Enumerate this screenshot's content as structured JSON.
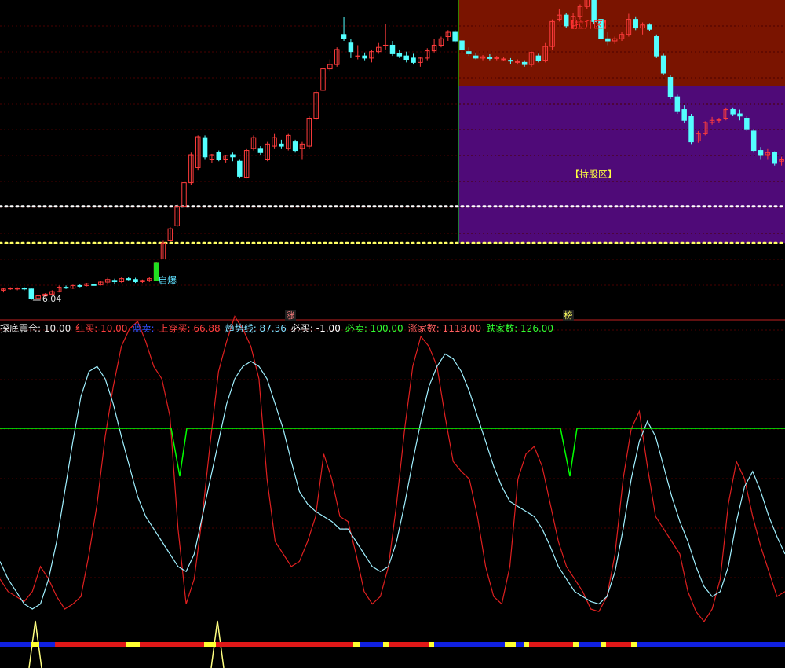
{
  "colors": {
    "background": "#000000",
    "candle_up": "#ff3c3c",
    "candle_down": "#54ffff",
    "zone_pull": "#7a1400",
    "zone_hold": "#4f0a78",
    "zone_divider": "#00d000",
    "dotted_line": "#ffffff",
    "dotted_line_low": "#ffff64",
    "grid": "#4a0000",
    "red_line": "#e02020",
    "cyan_line": "#a0f0ff",
    "green_line": "#00ff00",
    "yellow_spike": "#ffff80",
    "bar_red": "#e01818",
    "bar_blue": "#1020e0",
    "bar_yellow": "#ffff30",
    "panel_divider": "#c02020"
  },
  "price_panel": {
    "low_price_label": "6.04",
    "burst_label": "启爆",
    "pull_zone_label": "【拉升区】",
    "hold_zone_label": "【持股区】",
    "marker_rise": "涨",
    "marker_rank": "榜"
  },
  "indicator_legend": [
    {
      "name": "探底震仓",
      "value": "10.00",
      "color": "#e8e8e8"
    },
    {
      "name": "红买",
      "value": "10.00",
      "color": "#ff4040"
    },
    {
      "name": "蓝卖",
      "value": "",
      "color": "#3050ff"
    },
    {
      "name": "上穿买",
      "value": "66.88",
      "color": "#ff4040"
    },
    {
      "name": "趋势线",
      "value": "87.36",
      "color": "#80e0ff"
    },
    {
      "name": "必买",
      "value": "-1.00",
      "color": "#ffffff"
    },
    {
      "name": "必卖",
      "value": "100.00",
      "color": "#30ff30"
    },
    {
      "name": "涨家数",
      "value": "1118.00",
      "color": "#ff6060"
    },
    {
      "name": "跌家数",
      "value": "126.00",
      "color": "#30ff30"
    }
  ],
  "chart_data": [
    {
      "type": "candlestick",
      "title": "",
      "ylim": [
        5.6,
        13.0
      ],
      "reference_levels": [
        8.2,
        7.35
      ],
      "zones": [
        {
          "label": "【拉升区】",
          "from_index": 66,
          "y_range": [
            11.0,
            13.0
          ]
        },
        {
          "label": "【持股区】",
          "from_index": 66,
          "y_range": [
            7.35,
            11.0
          ]
        }
      ],
      "candles": [
        [
          6.25,
          6.3,
          6.2,
          6.28
        ],
        [
          6.3,
          6.32,
          6.26,
          6.3
        ],
        [
          6.28,
          6.32,
          6.25,
          6.3
        ],
        [
          6.3,
          6.32,
          6.25,
          6.28
        ],
        [
          6.28,
          6.3,
          6.02,
          6.06
        ],
        [
          6.06,
          6.14,
          6.04,
          6.12
        ],
        [
          6.12,
          6.18,
          6.1,
          6.16
        ],
        [
          6.16,
          6.25,
          6.14,
          6.22
        ],
        [
          6.22,
          6.36,
          6.2,
          6.32
        ],
        [
          6.32,
          6.36,
          6.28,
          6.3
        ],
        [
          6.3,
          6.38,
          6.28,
          6.36
        ],
        [
          6.36,
          6.4,
          6.32,
          6.35
        ],
        [
          6.36,
          6.42,
          6.34,
          6.4
        ],
        [
          6.38,
          6.4,
          6.36,
          6.37
        ],
        [
          6.38,
          6.46,
          6.36,
          6.44
        ],
        [
          6.44,
          6.54,
          6.4,
          6.5
        ],
        [
          6.48,
          6.52,
          6.4,
          6.45
        ],
        [
          6.45,
          6.55,
          6.42,
          6.52
        ],
        [
          6.52,
          6.56,
          6.48,
          6.5
        ],
        [
          6.5,
          6.54,
          6.42,
          6.45
        ],
        [
          6.45,
          6.5,
          6.42,
          6.48
        ],
        [
          6.48,
          6.55,
          6.44,
          6.52
        ],
        [
          6.52,
          6.9,
          6.5,
          6.88
        ],
        [
          6.98,
          7.4,
          6.98,
          7.35
        ],
        [
          7.4,
          7.72,
          7.38,
          7.68
        ],
        [
          7.75,
          8.25,
          7.72,
          8.2
        ],
        [
          8.2,
          8.8,
          8.15,
          8.75
        ],
        [
          8.75,
          9.45,
          8.7,
          9.4
        ],
        [
          9.1,
          9.85,
          9.05,
          9.82
        ],
        [
          9.8,
          9.85,
          9.3,
          9.35
        ],
        [
          9.3,
          9.42,
          9.2,
          9.4
        ],
        [
          9.45,
          9.5,
          9.25,
          9.3
        ],
        [
          9.3,
          9.4,
          9.22,
          9.38
        ],
        [
          9.4,
          9.45,
          9.25,
          9.35
        ],
        [
          9.25,
          9.3,
          8.85,
          8.9
        ],
        [
          8.88,
          9.55,
          8.85,
          9.5
        ],
        [
          9.55,
          9.85,
          9.5,
          9.8
        ],
        [
          9.55,
          9.6,
          9.4,
          9.45
        ],
        [
          9.3,
          9.7,
          9.25,
          9.65
        ],
        [
          9.6,
          9.9,
          9.55,
          9.8
        ],
        [
          9.65,
          9.75,
          9.55,
          9.6
        ],
        [
          9.55,
          9.9,
          9.5,
          9.85
        ],
        [
          9.7,
          9.75,
          9.45,
          9.5
        ],
        [
          9.55,
          9.7,
          9.3,
          9.65
        ],
        [
          9.6,
          10.3,
          9.55,
          10.25
        ],
        [
          10.25,
          10.9,
          10.2,
          10.85
        ],
        [
          10.9,
          11.45,
          10.85,
          11.4
        ],
        [
          11.4,
          11.62,
          11.35,
          11.5
        ],
        [
          11.5,
          11.9,
          11.45,
          11.85
        ],
        [
          12.2,
          12.6,
          12.05,
          12.1
        ],
        [
          12.0,
          12.1,
          11.65,
          11.8
        ],
        [
          11.68,
          11.95,
          11.62,
          11.7
        ],
        [
          11.7,
          11.78,
          11.6,
          11.65
        ],
        [
          11.65,
          11.85,
          11.55,
          11.8
        ],
        [
          11.8,
          12.0,
          11.75,
          11.9
        ],
        [
          11.95,
          12.45,
          11.85,
          11.95
        ],
        [
          11.95,
          12.05,
          11.7,
          11.75
        ],
        [
          11.75,
          11.85,
          11.65,
          11.7
        ],
        [
          11.7,
          11.8,
          11.55,
          11.62
        ],
        [
          11.65,
          11.75,
          11.5,
          11.55
        ],
        [
          11.55,
          11.68,
          11.45,
          11.65
        ],
        [
          11.65,
          11.88,
          11.6,
          11.82
        ],
        [
          11.82,
          12.1,
          11.78,
          11.95
        ],
        [
          11.95,
          12.15,
          11.9,
          12.1
        ],
        [
          12.15,
          12.3,
          12.05,
          12.25
        ],
        [
          12.25,
          12.3,
          12.0,
          12.05
        ],
        [
          12.05,
          12.1,
          11.8,
          11.85
        ],
        [
          11.8,
          11.9,
          11.7,
          11.75
        ],
        [
          11.7,
          11.78,
          11.62,
          11.65
        ],
        [
          11.65,
          11.72,
          11.6,
          11.68
        ],
        [
          11.66,
          11.74,
          11.6,
          11.64
        ],
        [
          11.64,
          11.7,
          11.6,
          11.66
        ],
        [
          11.62,
          11.68,
          11.58,
          11.63
        ],
        [
          11.6,
          11.65,
          11.52,
          11.58
        ],
        [
          11.55,
          11.62,
          11.5,
          11.57
        ],
        [
          11.55,
          11.6,
          11.45,
          11.5
        ],
        [
          11.5,
          11.8,
          11.45,
          11.78
        ],
        [
          11.7,
          11.75,
          11.55,
          11.6
        ],
        [
          11.6,
          12.0,
          11.55,
          11.92
        ],
        [
          11.92,
          12.55,
          11.85,
          12.5
        ],
        [
          12.55,
          12.8,
          12.5,
          12.65
        ],
        [
          12.65,
          12.7,
          12.35,
          12.4
        ],
        [
          12.4,
          12.7,
          12.35,
          12.62
        ],
        [
          12.62,
          12.9,
          12.55,
          12.85
        ],
        [
          12.85,
          13.1,
          12.8,
          13.05
        ],
        [
          13.05,
          13.15,
          12.45,
          12.5
        ],
        [
          12.55,
          12.7,
          11.4,
          12.1
        ],
        [
          12.1,
          12.25,
          11.95,
          12.05
        ],
        [
          12.05,
          12.15,
          11.98,
          12.1
        ],
        [
          12.1,
          12.25,
          12.05,
          12.2
        ],
        [
          12.2,
          12.68,
          12.15,
          12.55
        ],
        [
          12.55,
          12.62,
          12.3,
          12.35
        ],
        [
          12.35,
          12.48,
          12.2,
          12.42
        ],
        [
          12.42,
          12.46,
          12.28,
          12.32
        ],
        [
          12.15,
          12.2,
          11.65,
          11.7
        ],
        [
          11.7,
          11.75,
          11.25,
          11.3
        ],
        [
          11.2,
          11.25,
          10.7,
          10.75
        ],
        [
          10.75,
          10.8,
          10.35,
          10.42
        ],
        [
          10.45,
          10.55,
          10.15,
          10.2
        ],
        [
          10.3,
          10.35,
          9.65,
          9.7
        ],
        [
          9.72,
          9.95,
          9.68,
          9.9
        ],
        [
          9.9,
          10.18,
          9.85,
          10.15
        ],
        [
          10.15,
          10.28,
          10.1,
          10.2
        ],
        [
          10.2,
          10.26,
          10.15,
          10.22
        ],
        [
          10.25,
          10.5,
          10.2,
          10.45
        ],
        [
          10.45,
          10.5,
          10.3,
          10.35
        ],
        [
          10.35,
          10.45,
          10.2,
          10.3
        ],
        [
          10.25,
          10.3,
          9.95,
          10.0
        ],
        [
          9.95,
          10.0,
          9.45,
          9.5
        ],
        [
          9.5,
          9.58,
          9.3,
          9.4
        ],
        [
          9.4,
          9.55,
          9.3,
          9.45
        ],
        [
          9.45,
          9.48,
          9.15,
          9.2
        ],
        [
          9.25,
          9.35,
          9.15,
          9.3
        ]
      ]
    },
    {
      "type": "line",
      "title": "",
      "ylim": [
        -8,
        112
      ],
      "series": [
        {
          "name": "",
          "color_key": "red_line",
          "values": [
            15,
            10,
            8,
            6,
            10,
            20,
            15,
            8,
            3,
            5,
            8,
            25,
            45,
            72,
            92,
            108,
            115,
            118,
            110,
            100,
            95,
            80,
            35,
            5,
            15,
            40,
            70,
            98,
            110,
            120,
            115,
            108,
            95,
            55,
            30,
            25,
            20,
            22,
            30,
            40,
            65,
            55,
            40,
            38,
            25,
            10,
            5,
            8,
            20,
            45,
            75,
            100,
            112,
            108,
            100,
            80,
            62,
            58,
            55,
            40,
            20,
            8,
            5,
            20,
            55,
            65,
            68,
            60,
            45,
            30,
            20,
            15,
            10,
            3,
            2,
            8,
            25,
            55,
            75,
            82,
            60,
            40,
            35,
            30,
            25,
            10,
            2,
            -2,
            3,
            15,
            45,
            62,
            55,
            40,
            28,
            18,
            8,
            10
          ]
        },
        {
          "name": "",
          "color_key": "cyan_line",
          "values": [
            22,
            15,
            10,
            5,
            3,
            5,
            15,
            30,
            50,
            70,
            88,
            98,
            100,
            95,
            85,
            72,
            60,
            48,
            40,
            35,
            30,
            25,
            20,
            18,
            25,
            40,
            55,
            70,
            85,
            95,
            100,
            102,
            100,
            95,
            85,
            75,
            62,
            50,
            45,
            42,
            40,
            38,
            35,
            35,
            30,
            25,
            20,
            18,
            20,
            30,
            45,
            62,
            78,
            92,
            100,
            105,
            103,
            98,
            90,
            80,
            70,
            60,
            52,
            46,
            44,
            42,
            40,
            35,
            28,
            20,
            15,
            10,
            8,
            6,
            5,
            8,
            18,
            35,
            55,
            70,
            78,
            72,
            60,
            48,
            38,
            30,
            20,
            12,
            8,
            10,
            20,
            38,
            52,
            58,
            50,
            40,
            32,
            25
          ]
        }
      ]
    }
  ]
}
